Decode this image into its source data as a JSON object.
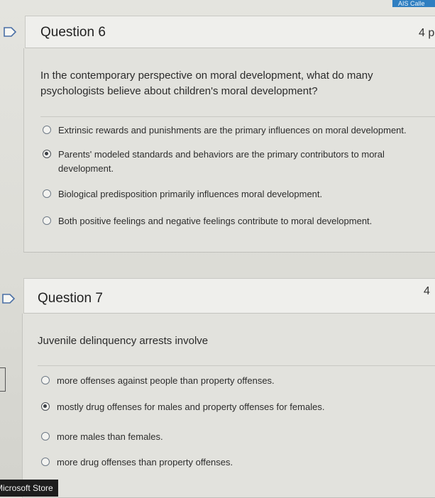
{
  "top_tab": {
    "label": "AIS Calle"
  },
  "question6": {
    "title": "Question 6",
    "points": "4 p",
    "prompt": "In the contemporary perspective on moral development, what do many psychologists believe about children's moral development?",
    "options": [
      {
        "label": "Extrinsic rewards and punishments are the primary influences on moral development.",
        "selected": false
      },
      {
        "label": "Parents' modeled standards and behaviors are the primary contributors to moral development.",
        "selected": true
      },
      {
        "label": "Biological predisposition primarily influences moral development.",
        "selected": false
      },
      {
        "label": "Both positive feelings and negative feelings contribute to moral development.",
        "selected": false
      }
    ]
  },
  "question7": {
    "title": "Question 7",
    "points": "4 ",
    "prompt": "Juvenile delinquency arrests involve",
    "options": [
      {
        "label": "more offenses against people than property offenses.",
        "selected": false
      },
      {
        "label": "mostly drug offenses for males and property offenses for females.",
        "selected": true
      },
      {
        "label": "more males than females.",
        "selected": false
      },
      {
        "label": "more drug offenses than property offenses.",
        "selected": false
      }
    ]
  },
  "taskbar": {
    "label": "Microsoft Store"
  },
  "icons": {
    "flag": "flag-icon",
    "radio": "radio-icon"
  }
}
